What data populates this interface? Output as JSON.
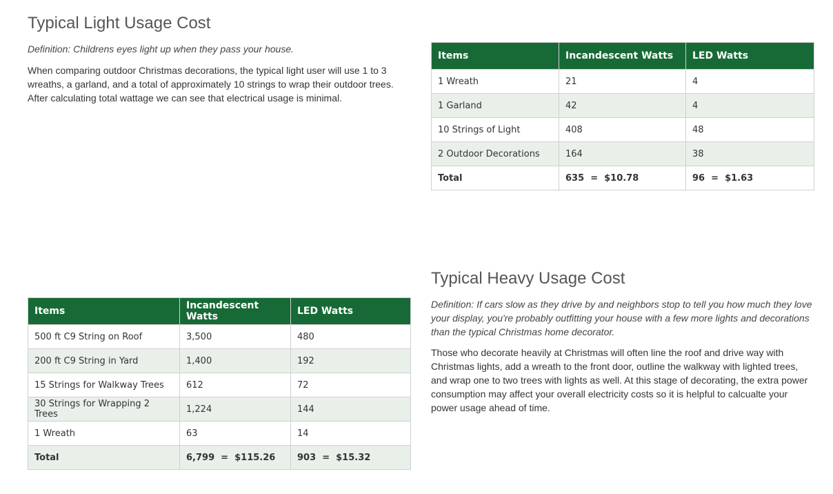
{
  "light": {
    "title": "Typical Light Usage Cost",
    "definition": "Definition: Childrens eyes light up when they pass your house.",
    "body_lines": [
      "When comparing outdoor Christmas decorations, the typical light user will use 1 to 3",
      "wreaths, a garland, and a total of approximately 10 strings to wrap their outdoor trees.",
      "After calculating total wattage we can see that electrical usage is minimal."
    ],
    "table": {
      "headers": [
        "Items",
        "Incandescent Watts",
        "LED Watts"
      ],
      "rows": [
        [
          "1 Wreath",
          "21",
          "4"
        ],
        [
          "1 Garland",
          "42",
          "4"
        ],
        [
          "10 Strings of Light",
          "408",
          "48"
        ],
        [
          "2 Outdoor Decorations",
          "164",
          "38"
        ]
      ],
      "total": [
        "Total",
        "635  =  $10.78",
        "96  =  $1.63"
      ]
    }
  },
  "heavy": {
    "title": "Typical Heavy Usage Cost",
    "definition_lines": [
      "Definition: If cars slow as they drive by and neighbors stop to tell you how much they love",
      "your display, you're probably outfitting your house with a few more lights and decorations",
      "than the typical Christmas home decorator."
    ],
    "body_lines": [
      "Those who decorate heavily at Christmas will often line the roof and drive way with",
      "Christmas lights, add a wreath to the front door, outline the walkway with lighted trees,",
      "and wrap one to two trees with lights as well. At this stage of decorating, the extra power",
      "consumption may affect your overall electricity costs so it is helpful to calcualte your",
      "power usage ahead of time."
    ],
    "table": {
      "headers": [
        "Items",
        "Incandescent Watts",
        "LED Watts"
      ],
      "rows": [
        [
          "500 ft C9 String on Roof",
          "3,500",
          "480"
        ],
        [
          "200 ft C9 String in Yard",
          "1,400",
          "192"
        ],
        [
          "15 Strings for Walkway Trees",
          "612",
          "72"
        ],
        [
          "30 Strings for Wrapping 2 Trees",
          "1,224",
          "144"
        ],
        [
          "1 Wreath",
          "63",
          "14"
        ]
      ],
      "total": [
        "Total",
        "6,799  =  $115.26",
        "903  =  $15.32"
      ]
    }
  },
  "colors": {
    "header_green": "#176a36",
    "stripe": "#e9f0ea"
  }
}
